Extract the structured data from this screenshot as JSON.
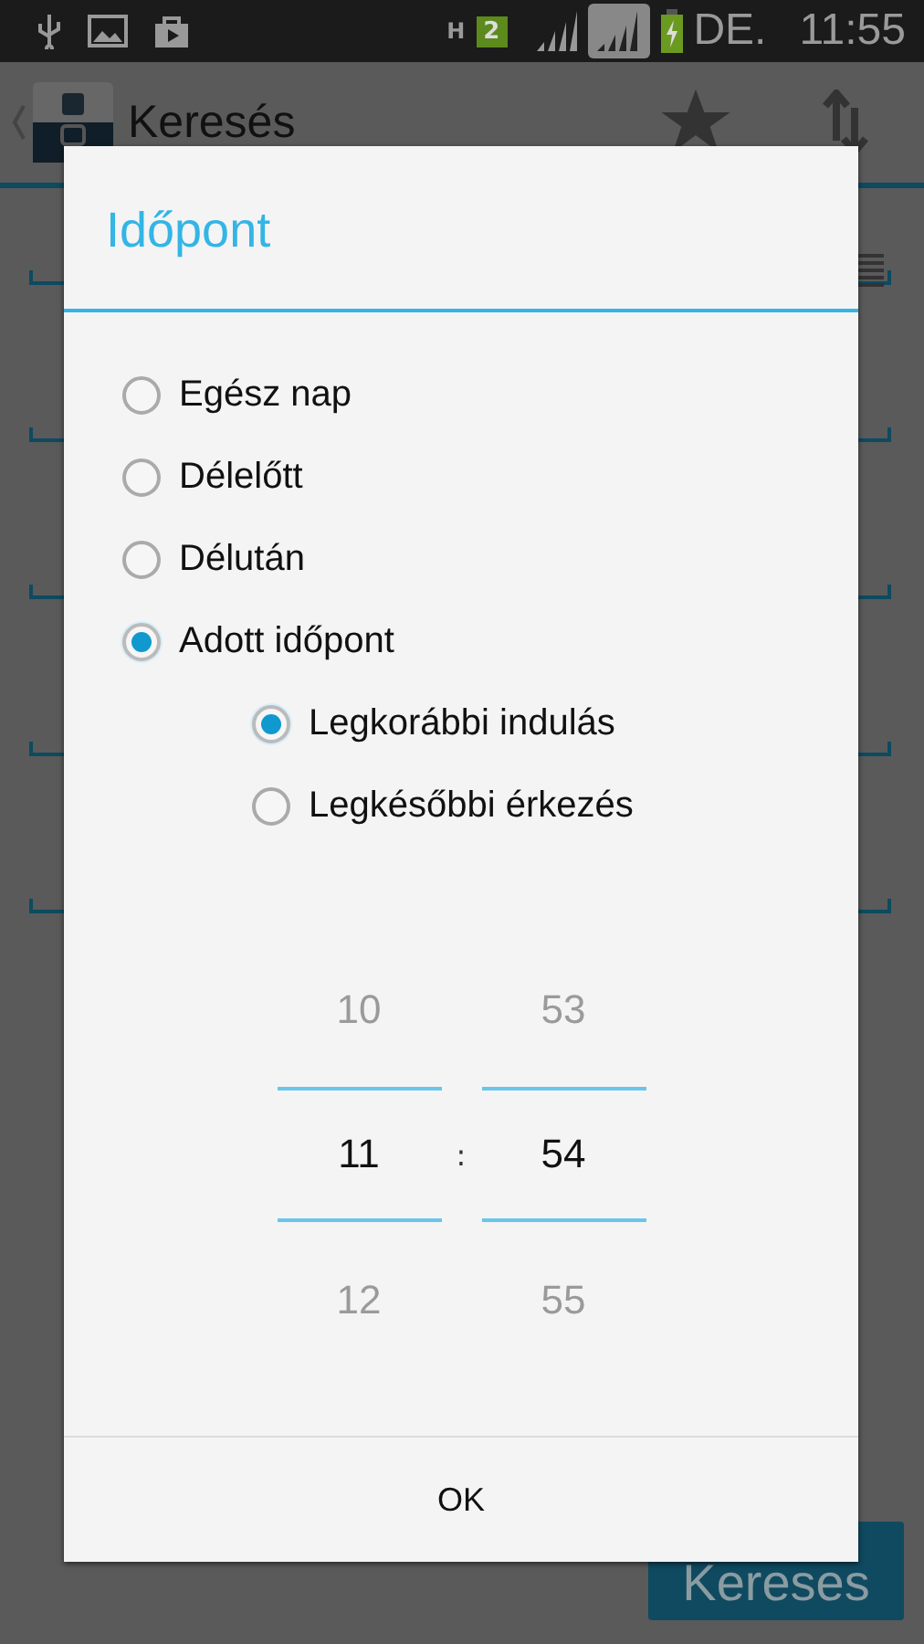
{
  "status_bar": {
    "network": "H",
    "sim": "2",
    "ampm": "DE.",
    "time": "11:55"
  },
  "app_bar": {
    "title": "Keresés"
  },
  "search_button": {
    "label": "Kereses"
  },
  "dialog": {
    "title": "Időpont",
    "options": [
      {
        "label": "Egész nap",
        "selected": false
      },
      {
        "label": "Délelőtt",
        "selected": false
      },
      {
        "label": "Délután",
        "selected": false
      },
      {
        "label": "Adott időpont",
        "selected": true,
        "children": [
          {
            "label": "Legkorábbi indulás",
            "selected": true
          },
          {
            "label": "Legkésőbbi érkezés",
            "selected": false
          }
        ]
      }
    ],
    "picker": {
      "hours": [
        "10",
        "11",
        "12"
      ],
      "separator": ":",
      "minutes": [
        "53",
        "54",
        "55"
      ]
    },
    "button": "OK"
  }
}
